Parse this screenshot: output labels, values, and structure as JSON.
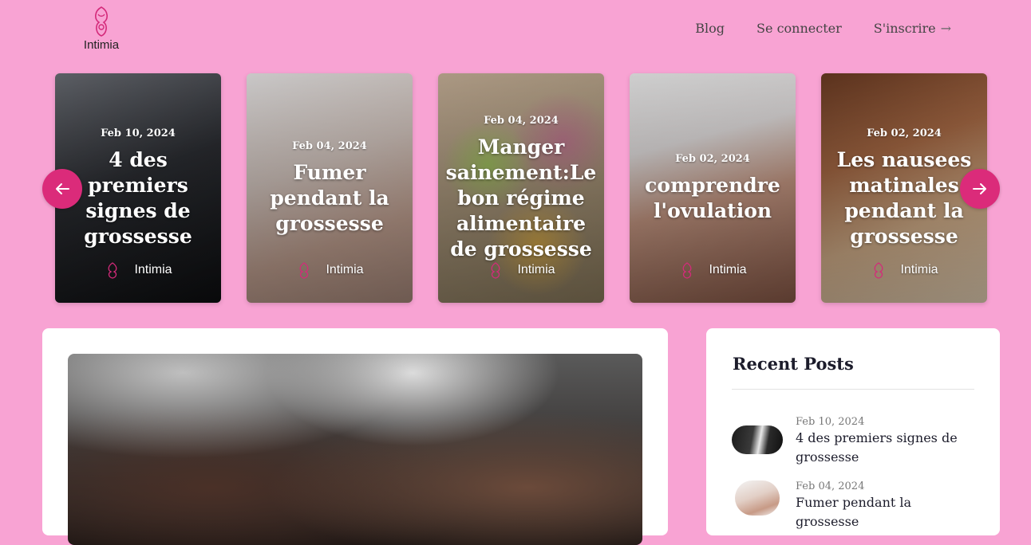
{
  "brand": {
    "name": "Intimia"
  },
  "nav": {
    "blog": "Blog",
    "login": "Se connecter",
    "signup": "S'inscrire"
  },
  "carousel": {
    "cards": [
      {
        "date": "Feb 10, 2024",
        "title": "4 des premiers signes de grossesse",
        "author": "Intimia"
      },
      {
        "date": "Feb 04, 2024",
        "title": "Fumer pendant la grossesse",
        "author": "Intimia"
      },
      {
        "date": "Feb 04, 2024",
        "title": "Manger sainement:Le bon régime alimentaire de grossesse",
        "author": "Intimia"
      },
      {
        "date": "Feb 02, 2024",
        "title": "comprendre l'ovulation",
        "author": "Intimia"
      },
      {
        "date": "Feb 02, 2024",
        "title": "Les nausees matinales pendant la grossesse",
        "author": "Intimia"
      }
    ]
  },
  "sidebar": {
    "title": "Recent Posts",
    "posts": [
      {
        "date": "Feb 10, 2024",
        "title": "4 des premiers signes de grossesse"
      },
      {
        "date": "Feb 04, 2024",
        "title": "Fumer pendant la grossesse"
      }
    ]
  },
  "colors": {
    "background": "#f8a3d3",
    "accent": "#db2b7a"
  }
}
